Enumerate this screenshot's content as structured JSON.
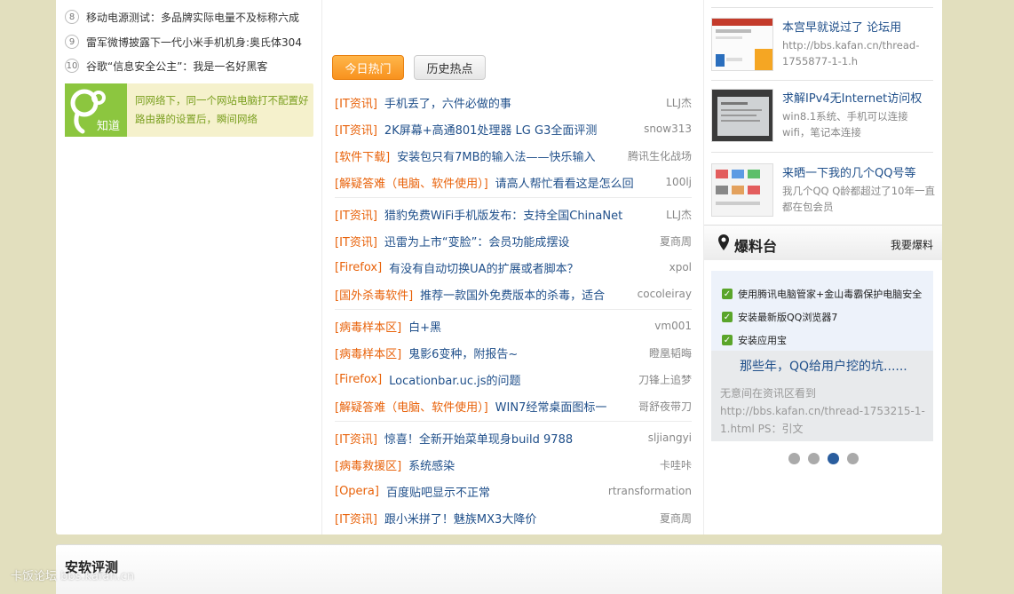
{
  "ranking": [
    {
      "num": "8",
      "text": "移动电源测试：多品牌实际电量不及标称六成"
    },
    {
      "num": "9",
      "text": "雷军微博披露下一代小米手机机身:奥氏体304"
    },
    {
      "num": "10",
      "text": "谷歌“信息安全公主”：我是一名好黑客"
    }
  ],
  "zhidao": {
    "logo_text": "知道",
    "text": "同网络下，同一个网站电脑打不配置好路由器的设置后，瞬间网络"
  },
  "tabs": {
    "today": "今日热门",
    "history": "历史热点"
  },
  "threads": [
    {
      "cat": "[IT资讯]",
      "title": "手机丢了，六件必做的事",
      "author": "LLJ杰"
    },
    {
      "cat": "[IT资讯]",
      "title": "2K屏幕+高通801处理器 LG G3全面评测",
      "author": "snow313"
    },
    {
      "cat": "[软件下载]",
      "title": "安装包只有7MB的输入法——快乐输入",
      "author": "腾讯生化战场"
    },
    {
      "cat": "[解疑答难（电脑、软件使用）]",
      "title": "请高人帮忙看看这是怎么回",
      "author": "100lj"
    },
    {
      "cat": "[IT资讯]",
      "title": "猎豹免费WiFi手机版发布：支持全国ChinaNet",
      "author": "LLJ杰"
    },
    {
      "cat": "[IT资讯]",
      "title": "迅雷为上市“变脸”：会员功能成摆设",
      "author": "夏商周"
    },
    {
      "cat": "[Firefox]",
      "title": "有没有自动切换UA的扩展或者脚本？",
      "author": "xpol"
    },
    {
      "cat": "[国外杀毒软件]",
      "title": "推荐一款国外免费版本的杀毒，适合",
      "author": "cocoleiray"
    },
    {
      "cat": "[病毒样本区]",
      "title": "白+黑",
      "author": "vm001"
    },
    {
      "cat": "[病毒样本区]",
      "title": "鬼影6变种，附报告~",
      "author": "瞪凰韬晦"
    },
    {
      "cat": "[Firefox]",
      "title": "Locationbar.uc.js的问题",
      "author": "刀锋上追梦"
    },
    {
      "cat": "[解疑答难（电脑、软件使用）]",
      "title": "WIN7经常桌面图标一",
      "author": "哥舒夜带刀"
    },
    {
      "cat": "[IT资讯]",
      "title": "惊喜！全新开始菜单现身build 9788",
      "author": "sljiangyi"
    },
    {
      "cat": "[病毒救援区]",
      "title": "系统感染",
      "author": "卡哇咔"
    },
    {
      "cat": "[Opera]",
      "title": "百度贴吧显示不正常",
      "author": "rtransformation"
    },
    {
      "cat": "[IT资讯]",
      "title": "跟小米拼了！魅族MX3大降价",
      "author": "夏商周"
    }
  ],
  "news": [
    {
      "title": "本宫早就说过了 论坛用",
      "desc": "http://bbs.kafan.cn/thread-1755877-1-1.h"
    },
    {
      "title": "求解IPv4无Internet访问权",
      "desc": "win8.1系统、手机可以连接wifi，笔记本连接"
    },
    {
      "title": "来晒一下我的几个QQ号等",
      "desc": "我几个QQ Q龄都超过了10年一直都在包会员"
    }
  ],
  "baoliao": {
    "title": "爆料台",
    "action": "我要爆料",
    "checks": [
      "使用腾讯电脑管家+金山毒霸保护电脑安全",
      "安装最新版QQ浏览器7",
      "安装应用宝"
    ],
    "caption": "那些年，QQ给用户挖的坑......",
    "desc": "无意间在资讯区看到 http://bbs.kafan.cn/thread-1753215-1-1.html PS：引文"
  },
  "carousel": {
    "count": 4,
    "active": 2
  },
  "bottom": {
    "title": "安软评测"
  },
  "watermark": "卡饭论坛 bbs.kafan.cn",
  "colors": {
    "category": "#e8620a",
    "link": "#1f4f8a",
    "tab_active": "#f8921e",
    "page_bg": "#e2dfbe"
  }
}
